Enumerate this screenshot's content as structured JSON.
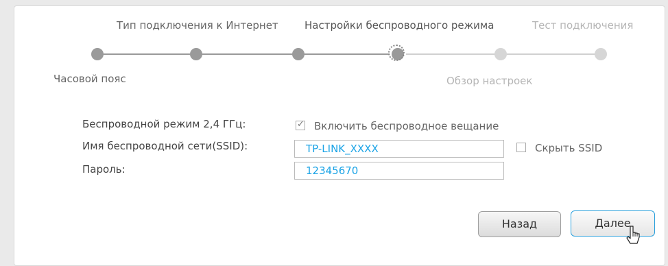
{
  "wizard": {
    "steps": [
      {
        "label": "Часовой пояс",
        "state": "done"
      },
      {
        "label": "Тип подключения к Интернет",
        "state": "done"
      },
      {
        "label": "",
        "state": "done"
      },
      {
        "label": "Настройки беспроводного режима",
        "state": "current"
      },
      {
        "label": "Обзор настроек",
        "state": "future"
      },
      {
        "label": "Тест подключения",
        "state": "future"
      }
    ]
  },
  "form": {
    "wireless_label": "Беспроводной режим 2,4 ГГц:",
    "broadcast_checkbox": {
      "label": "Включить беспроводное вещание",
      "checked": true
    },
    "ssid_label": "Имя беспроводной сети(SSID):",
    "ssid_value": "TP-LINK_XXXX",
    "hide_ssid_checkbox": {
      "label": "Скрыть SSID",
      "checked": false
    },
    "password_label": "Пароль:",
    "password_value": "12345670"
  },
  "buttons": {
    "back_label": "Назад",
    "next_label": "Далее"
  },
  "colors": {
    "accent": "#1aa3e6",
    "step_done": "#9a9a9a",
    "step_future": "#d6d6d6"
  }
}
